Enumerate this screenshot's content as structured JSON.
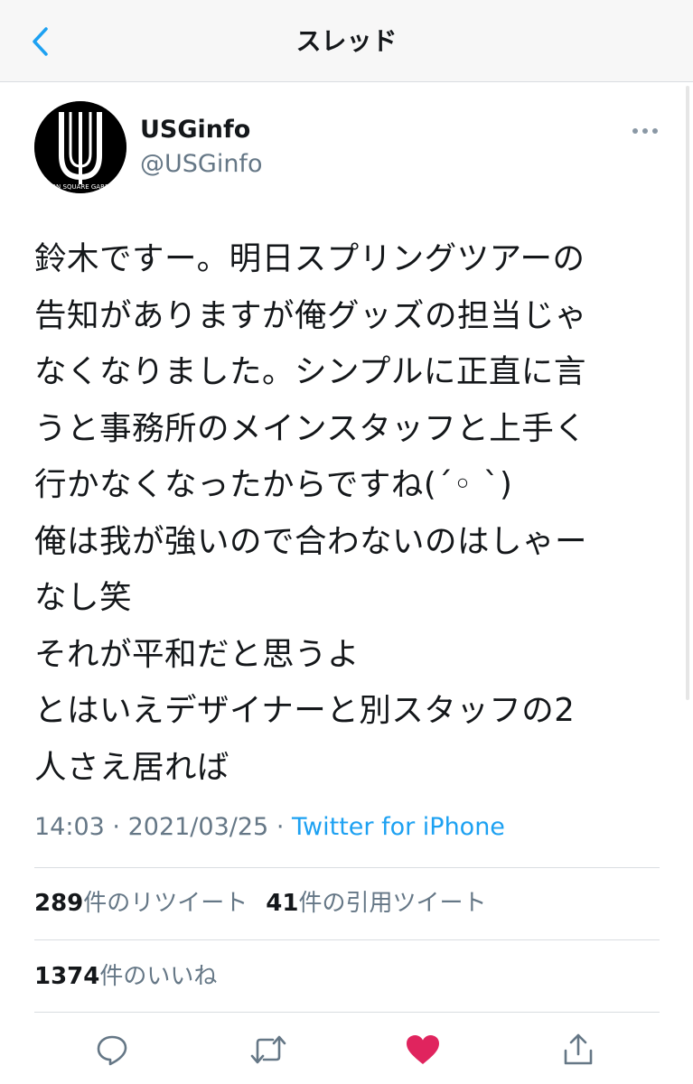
{
  "header": {
    "title": "スレッド",
    "back_icon": "chevron-left-icon"
  },
  "colors": {
    "accent": "#1da1f2",
    "secondary_text": "#657786",
    "like": "#e0245e",
    "divider": "#d9dde1"
  },
  "tweet": {
    "avatar_text": "USON SQUARE GARDEN",
    "display_name": "USGinfo",
    "handle": "@USGinfo",
    "more_icon": "more-horizontal-icon",
    "text": "鈴木ですー。明日スプリングツアーの\n告知がありますが俺グッズの担当じゃ\nなくなりました。シンプルに正直に言\nうと事務所のメインスタッフと上手く\n行かなくなったからですね(´◦ `)\n俺は我が強いので合わないのはしゃー\nなし笑\nそれが平和だと思うよ\nとはいえデザイナーと別スタッフの2\n人さえ居れば",
    "time": "14:03",
    "date": "2021/03/25",
    "separator": "·",
    "source": "Twitter for iPhone"
  },
  "stats": {
    "retweets_count": "289",
    "retweets_label": "件のリツイート",
    "quotes_count": "41",
    "quotes_label": "件の引用ツイート",
    "likes_count": "1374",
    "likes_label": "件のいいね"
  },
  "actions": [
    {
      "name": "reply-icon"
    },
    {
      "name": "retweet-icon"
    },
    {
      "name": "like-icon"
    },
    {
      "name": "share-icon"
    }
  ]
}
